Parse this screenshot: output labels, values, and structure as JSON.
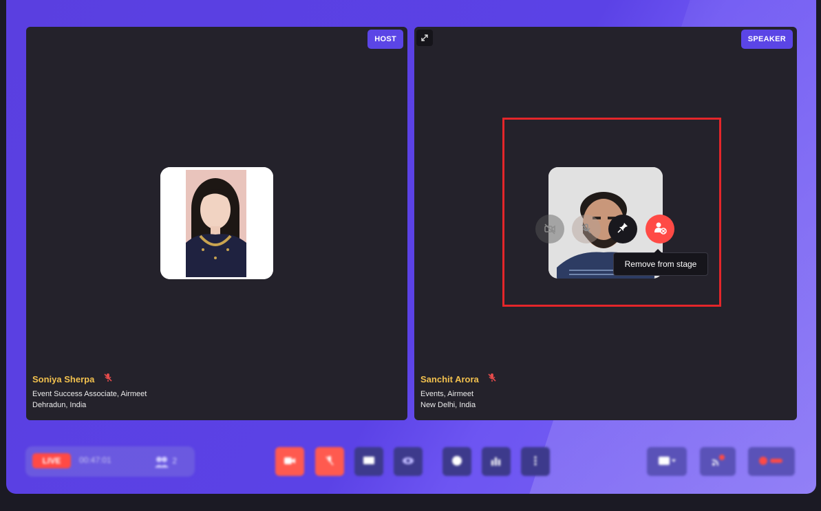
{
  "left_tile": {
    "badge": "HOST",
    "name": "Soniya Sherpa",
    "title": "Event Success Associate, Airmeet",
    "location": "Dehradun, India"
  },
  "right_tile": {
    "badge": "SPEAKER",
    "name": "Sanchit Arora",
    "title": "Events, Airmeet",
    "location": "New Delhi, India",
    "tooltip": "Remove from stage"
  },
  "toolbar": {
    "live_label": "LIVE",
    "timer": "00:47:01",
    "viewer_count": "2"
  },
  "colors": {
    "brand": "#5b45e6",
    "name_gold": "#f2c14e",
    "danger": "#ff4a45",
    "highlight": "#e4262a"
  }
}
